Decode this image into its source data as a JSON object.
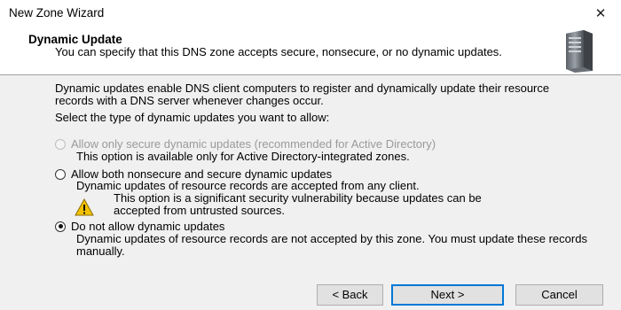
{
  "window": {
    "title": "New Zone Wizard",
    "close_glyph": "✕"
  },
  "header": {
    "title": "Dynamic Update",
    "subtitle": "You can specify that this DNS zone accepts secure, nonsecure, or no dynamic updates.",
    "icon": "server-icon"
  },
  "content": {
    "intro": "Dynamic updates enable DNS client computers to register and dynamically update their resource records with a DNS server whenever changes occur.",
    "prompt": "Select the type of dynamic updates you want to allow:",
    "options": [
      {
        "label": "Allow only secure dynamic updates (recommended for Active Directory)",
        "description": "This option is available only for Active Directory-integrated zones.",
        "selected": false,
        "enabled": false
      },
      {
        "label": "Allow both nonsecure and secure dynamic updates",
        "description": "Dynamic updates of resource records are accepted from any client.",
        "warning": "This option is a significant security vulnerability because updates can be accepted from untrusted sources.",
        "selected": false,
        "enabled": true
      },
      {
        "label": "Do not allow dynamic updates",
        "description": "Dynamic updates of resource records are not accepted by this zone. You must update these records manually.",
        "selected": true,
        "enabled": true
      }
    ]
  },
  "buttons": {
    "back": "< Back",
    "next": "Next >",
    "cancel": "Cancel"
  },
  "colors": {
    "accent": "#0078d7",
    "panel_bg": "#f0f0f0",
    "warning": "#f2c200"
  }
}
